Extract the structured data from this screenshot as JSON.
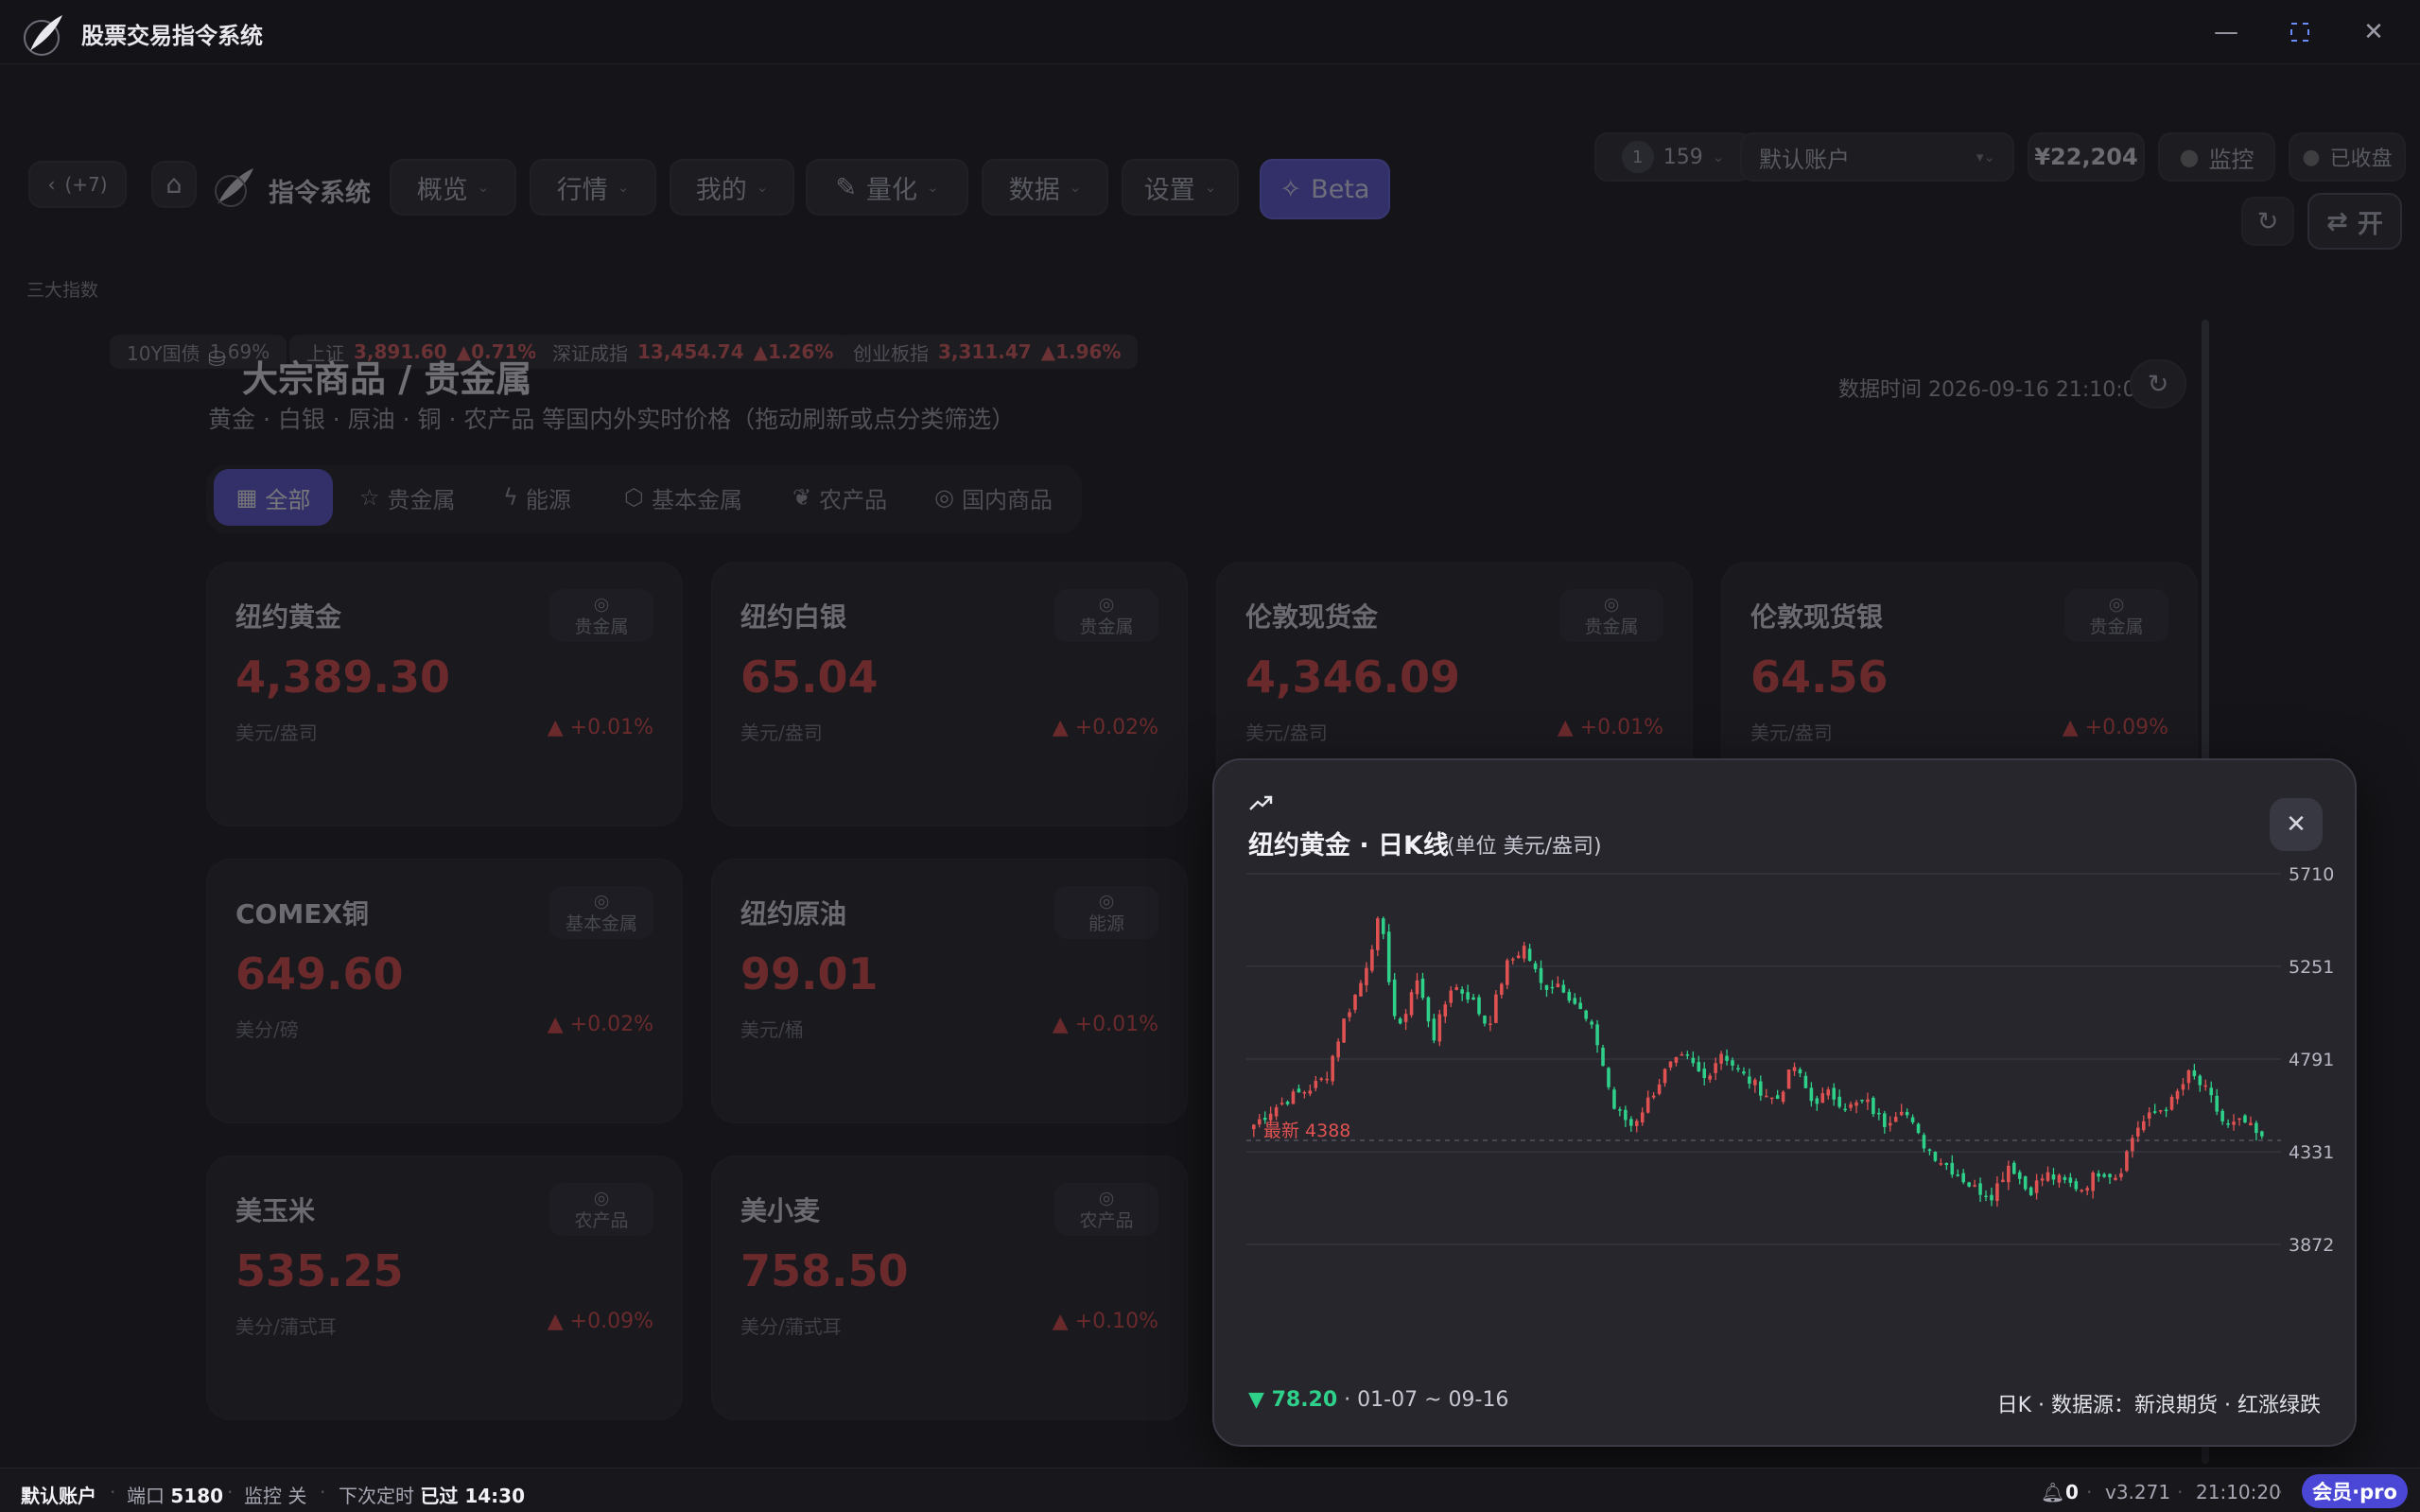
{
  "window": {
    "title": "股票交易指令系统",
    "controls": {
      "minimize": "—",
      "maximize": "⛶",
      "close": "✕"
    }
  },
  "toolbar": {
    "back_label": "(+7)",
    "brand": "指令系统",
    "nav": [
      {
        "label": "概览"
      },
      {
        "label": "行情"
      },
      {
        "label": "我的"
      },
      {
        "label": "量化"
      },
      {
        "label": "数据"
      },
      {
        "label": "设置"
      }
    ],
    "beta_label": "Beta",
    "badge_count": "1",
    "counter": "159",
    "account_select": "默认账户",
    "balance": "¥22,204",
    "monitor_label": "监控",
    "closed_label": "已收盘",
    "open_label": "开"
  },
  "indices": {
    "label": "三大指数",
    "items": [
      {
        "name": "10Y国债",
        "value": "1.69%",
        "change": ""
      },
      {
        "name": "上证",
        "value": "3,891.60",
        "change": "▲0.71%"
      },
      {
        "name": "深证成指",
        "value": "13,454.74",
        "change": "▲1.26%"
      },
      {
        "name": "创业板指",
        "value": "3,311.47",
        "change": "▲1.96%"
      }
    ]
  },
  "page": {
    "title": "大宗商品 / 贵金属",
    "subtitle": "黄金 · 白银 · 原油 · 铜 · 农产品 等国内外实时价格（拖动刷新或点分类筛选）",
    "timestamp": "数据时间 2026-09-16 21:10:09",
    "tabs": [
      {
        "label": "全部",
        "active": true
      },
      {
        "label": "贵金属"
      },
      {
        "label": "能源"
      },
      {
        "label": "基本金属"
      },
      {
        "label": "农产品"
      },
      {
        "label": "国内商品"
      }
    ],
    "cards": [
      {
        "name": "纽约黄金",
        "price": "4,389.30",
        "unit": "美元/盎司",
        "change": "▲ +0.01%",
        "category": "贵金属"
      },
      {
        "name": "纽约白银",
        "price": "65.04",
        "unit": "美元/盎司",
        "change": "▲ +0.02%",
        "category": "贵金属"
      },
      {
        "name": "伦敦现货金",
        "price": "4,346.09",
        "unit": "美元/盎司",
        "change": "▲ +0.01%",
        "category": "贵金属"
      },
      {
        "name": "伦敦现货银",
        "price": "64.56",
        "unit": "美元/盎司",
        "change": "▲ +0.09%",
        "category": "贵金属"
      },
      {
        "name": "COMEX铜",
        "price": "649.60",
        "unit": "美分/磅",
        "change": "▲ +0.02%",
        "category": "基本金属"
      },
      {
        "name": "纽约原油",
        "price": "99.01",
        "unit": "美元/桶",
        "change": "▲ +0.01%",
        "category": "能源"
      },
      {
        "name": "美玉米",
        "price": "535.25",
        "unit": "美分/蒲式耳",
        "change": "▲ +0.09%",
        "category": "农产品"
      },
      {
        "name": "美小麦",
        "price": "758.50",
        "unit": "美分/蒲式耳",
        "change": "▲ +0.10%",
        "category": "农产品"
      }
    ]
  },
  "modal": {
    "title": "纽约黄金 · 日K线",
    "unit": "(单位 美元/盎司)",
    "close_label": "✕",
    "footer_change": "▼ 78.20",
    "footer_range": "· 01-07 ~ 09-16",
    "footer_source": "日K · 数据源：新浪期货 · 红涨绿跌",
    "latest_label": "最新 4388"
  },
  "chart_data": {
    "type": "candlestick",
    "title": "纽约黄金 · 日K线",
    "ylabel": "美元/盎司",
    "y_ticks": [
      5710,
      5251,
      4791,
      4331,
      3872
    ],
    "ylim": [
      3872,
      5710
    ],
    "x_range": [
      "01-07",
      "09-16"
    ],
    "latest": 4388,
    "up_color": "#e05252",
    "down_color": "#2fd08a",
    "close_path": [
      4466,
      4540,
      4600,
      4640,
      4700,
      4980,
      5180,
      5500,
      4900,
      5200,
      4900,
      5160,
      5100,
      4950,
      5250,
      5350,
      5150,
      5170,
      5050,
      4900,
      4550,
      4460,
      4600,
      4750,
      4800,
      4690,
      4830,
      4720,
      4650,
      4580,
      4760,
      4580,
      4620,
      4550,
      4580,
      4470,
      4560,
      4390,
      4300,
      4230,
      4150,
      4120,
      4280,
      4130,
      4220,
      4180,
      4150,
      4240,
      4210,
      4450,
      4520,
      4580,
      4720,
      4620,
      4450,
      4480,
      4388
    ]
  },
  "status": {
    "account": "默认账户",
    "port_label": "端口",
    "port": "5180",
    "monitor": "监控 关",
    "next_label": "下次定时",
    "next": "已过 14:30",
    "notifications": "0",
    "version": "v3.271",
    "time": "21:10:20",
    "pro": "会员·pro"
  }
}
